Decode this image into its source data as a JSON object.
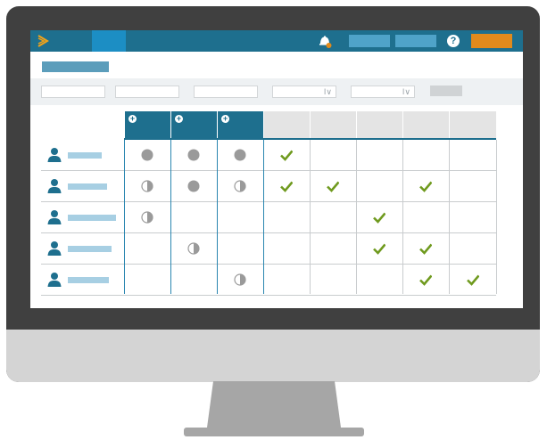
{
  "colors": {
    "monitor_bezel": "#404040",
    "monitor_chin": "#d4d4d4",
    "stand": "#a6a6a6",
    "topbar": "#1e6f8e",
    "nav_active": "#1c8ec4",
    "accent_orange": "#e18a1c",
    "check_green": "#6f9a1e",
    "status_gray": "#9a9a9a",
    "person_blue": "#1e6f8e"
  },
  "icons": {
    "logo": "chevron-logo-icon",
    "notification": "bell-icon",
    "help": "question-icon",
    "add_column": "plus-circle-icon",
    "user": "person-icon",
    "full_status": "filled-circle-icon",
    "partial_status": "half-circle-icon",
    "done": "checkmark-icon",
    "dropdown": "chevron-down-icon"
  },
  "topbar": {
    "help_glyph": "?"
  },
  "filters": {
    "select_caret": "I∨"
  },
  "header_columns": [
    {
      "type": "add"
    },
    {
      "type": "add"
    },
    {
      "type": "add"
    },
    {
      "type": "empty"
    },
    {
      "type": "empty"
    },
    {
      "type": "empty"
    },
    {
      "type": "empty"
    },
    {
      "type": "empty"
    }
  ],
  "rows": [
    {
      "cells": [
        "full",
        "full",
        "full",
        "check",
        "",
        "",
        "",
        ""
      ]
    },
    {
      "cells": [
        "half",
        "full",
        "half",
        "check",
        "check",
        "",
        "check",
        ""
      ]
    },
    {
      "cells": [
        "half",
        "",
        "",
        "",
        "",
        "check",
        "",
        ""
      ]
    },
    {
      "cells": [
        "",
        "half",
        "",
        "",
        "",
        "check",
        "check",
        ""
      ]
    },
    {
      "cells": [
        "",
        "",
        "half",
        "",
        "",
        "",
        "check",
        "check"
      ]
    }
  ]
}
